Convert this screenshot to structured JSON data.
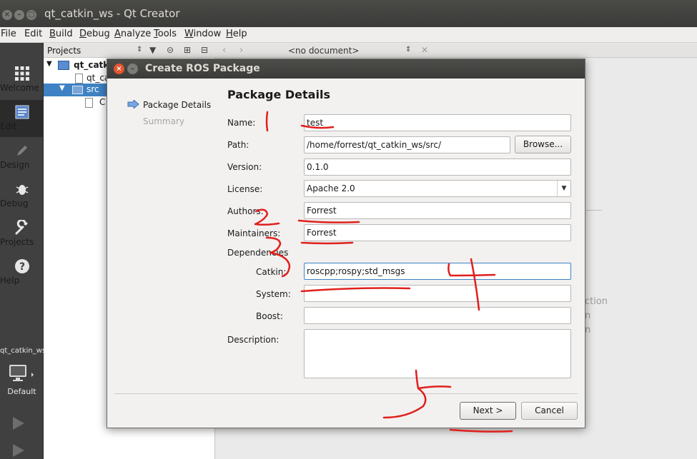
{
  "window": {
    "title": "qt_catkin_ws - Qt Creator"
  },
  "menubar": {
    "items": [
      "File",
      "Edit",
      "Build",
      "Debug",
      "Analyze",
      "Tools",
      "Window",
      "Help"
    ]
  },
  "modes": [
    {
      "label": "Welcome",
      "icon": "grid-icon"
    },
    {
      "label": "Edit",
      "icon": "document-icon"
    },
    {
      "label": "Design",
      "icon": "pencil-icon"
    },
    {
      "label": "Debug",
      "icon": "bug-icon"
    },
    {
      "label": "Projects",
      "icon": "wrench-icon"
    },
    {
      "label": "Help",
      "icon": "help-icon"
    }
  ],
  "kit": {
    "project": "qt_catkin_ws",
    "config": "Default"
  },
  "projects_pane": {
    "title": "Projects",
    "tree": [
      "qt_catkin",
      "qt_ca",
      "src",
      "C"
    ]
  },
  "document_bar": {
    "label": "<no document>"
  },
  "dialog": {
    "title": "Create ROS Package",
    "steps": [
      "Package Details",
      "Summary"
    ],
    "heading": "Package Details",
    "fields": {
      "name": {
        "label": "Name:",
        "value": "test"
      },
      "path": {
        "label": "Path:",
        "value": "/home/forrest/qt_catkin_ws/src/",
        "browse": "Browse..."
      },
      "version": {
        "label": "Version:",
        "value": "0.1.0"
      },
      "license": {
        "label": "License:",
        "value": "Apache 2.0"
      },
      "authors": {
        "label": "Authors:",
        "value": "Forrest"
      },
      "maintainers": {
        "label": "Maintainers:",
        "value": "Forrest"
      },
      "dependencies_label": "Dependencies",
      "catkin": {
        "label": "Catkin:",
        "value": "roscpp;rospy;std_msgs"
      },
      "system": {
        "label": "System:",
        "value": ""
      },
      "boost": {
        "label": "Boost:",
        "value": ""
      },
      "description": {
        "label": "Description:",
        "value": ""
      }
    },
    "buttons": {
      "next": "Next >",
      "cancel": "Cancel"
    }
  },
  "annotations": {
    "color": "#e0201c",
    "numbers": [
      "1",
      "2",
      "3",
      "4",
      "5"
    ]
  },
  "editor_ghost_text": [
    "ction",
    "n",
    "n"
  ]
}
